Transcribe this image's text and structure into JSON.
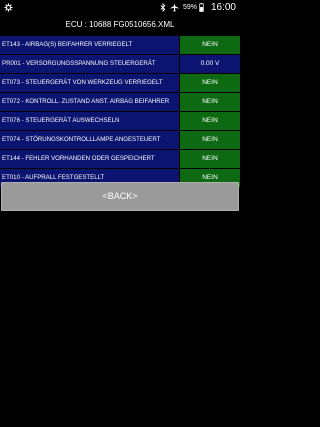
{
  "status_bar": {
    "battery_percent": "59%",
    "time": "16:00",
    "icons": [
      "settings-icon",
      "bluetooth-icon",
      "airplane-mode-icon",
      "battery-icon"
    ]
  },
  "header": {
    "title": "ECU : 10688  FG0510656.XML"
  },
  "rows": [
    {
      "label": "ET143 - AIRBAG(S) BEIFAHRER VERRIEGELT",
      "value": "NEIN",
      "status": "green"
    },
    {
      "label": "PR001 - VERSORGUNGSSPANNUNG STEUERGERÄT",
      "value": "0.00 V",
      "status": "blue"
    },
    {
      "label": "ET073 - STEUERGERÄT VON WERKZEUG VERRIEGELT",
      "value": "NEIN",
      "status": "green"
    },
    {
      "label": "ET072 - KONTROLL. ZUSTAND ANST. AIRBAG BEIFAHRER",
      "value": "NEIN",
      "status": "green"
    },
    {
      "label": "ET076 - STEUERGERÄT AUSWECHSELN",
      "value": "NEIN",
      "status": "green"
    },
    {
      "label": "ET074 - STÖRUNGSKONTROLLLAMPE ANGESTEUERT",
      "value": "NEIN",
      "status": "green"
    },
    {
      "label": "ET144 - FEHLER VORHANDEN ODER GESPEICHERT",
      "value": "NEIN",
      "status": "green"
    },
    {
      "label": "ET010 - AUFPRALL FESTGESTELLT",
      "value": "NEIN",
      "status": "green"
    }
  ],
  "actions": {
    "back_label": "<BACK>"
  },
  "colors": {
    "row_label_bg": "#0b1470",
    "value_green": "#0d6a13",
    "value_blue": "#0b1470",
    "button_bg": "#9a9a9a"
  }
}
